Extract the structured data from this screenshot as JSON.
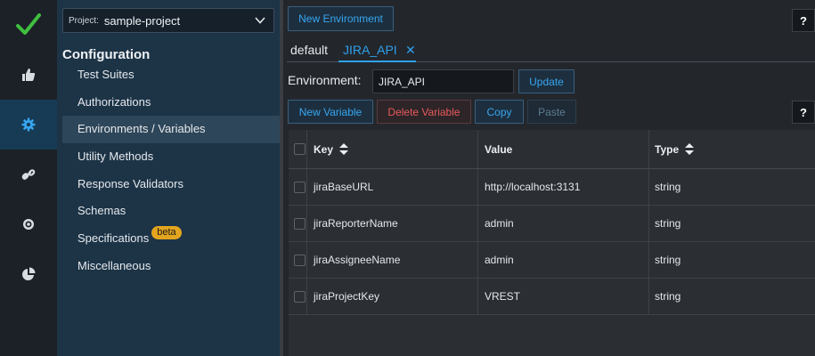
{
  "rail": {
    "items": [
      {
        "name": "checkmark-icon"
      },
      {
        "name": "thumbs-up-icon"
      },
      {
        "name": "gear-icon",
        "active": true
      },
      {
        "name": "link-icon"
      },
      {
        "name": "target-icon"
      },
      {
        "name": "pie-chart-icon"
      }
    ]
  },
  "sidebar": {
    "project_label": "Project:",
    "project_name": "sample-project",
    "section_title": "Configuration",
    "items": [
      {
        "label": "Test Suites"
      },
      {
        "label": "Authorizations"
      },
      {
        "label": "Environments / Variables",
        "active": true
      },
      {
        "label": "Utility Methods"
      },
      {
        "label": "Response Validators"
      },
      {
        "label": "Schemas"
      },
      {
        "label": "Specifications",
        "badge": "beta"
      },
      {
        "label": "Miscellaneous"
      }
    ]
  },
  "toolbar": {
    "new_environment": "New Environment",
    "help": "?"
  },
  "tabs": [
    {
      "label": "default"
    },
    {
      "label": "JIRA_API",
      "active": true,
      "close": "✕"
    }
  ],
  "environment": {
    "label": "Environment:",
    "value": "JIRA_API",
    "update": "Update"
  },
  "actions": {
    "new_variable": "New Variable",
    "delete_variable": "Delete Variable",
    "copy": "Copy",
    "paste": "Paste",
    "help": "?"
  },
  "table": {
    "headers": {
      "key": "Key",
      "value": "Value",
      "type": "Type"
    },
    "rows": [
      {
        "key": "jiraBaseURL",
        "value": "http://localhost:3131",
        "type": "string"
      },
      {
        "key": "jiraReporterName",
        "value": "admin",
        "type": "string"
      },
      {
        "key": "jiraAssigneeName",
        "value": "admin",
        "type": "string"
      },
      {
        "key": "jiraProjectKey",
        "value": "VREST",
        "type": "string"
      }
    ]
  },
  "colors": {
    "accent": "#2fa0ec",
    "danger": "#e85a5a",
    "badge": "#e3a51e",
    "check": "#3fbf3f"
  }
}
